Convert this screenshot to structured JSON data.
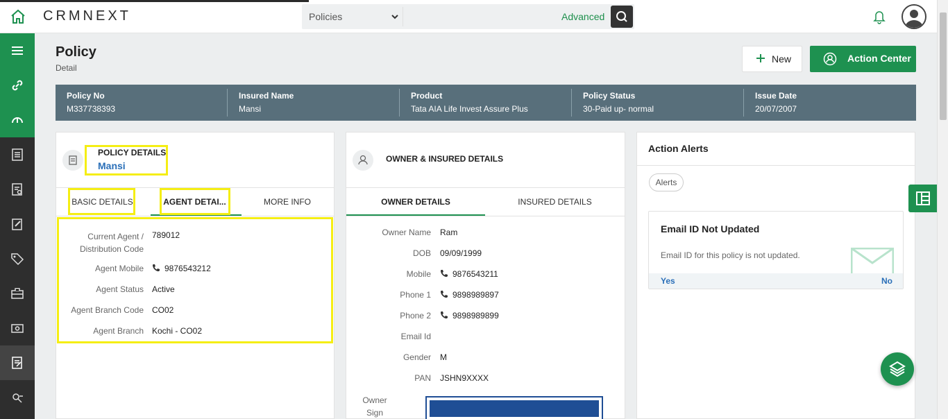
{
  "app": {
    "logo": "CRMNEXT"
  },
  "search": {
    "module": "Policies",
    "advanced_label": "Advanced"
  },
  "page": {
    "title": "Policy",
    "subtitle": "Detail"
  },
  "actions": {
    "new_label": "New",
    "action_center_label": "Action Center"
  },
  "summary": [
    {
      "key": "Policy No",
      "value": "M337738393"
    },
    {
      "key": "Insured Name",
      "value": "Mansi"
    },
    {
      "key": "Product",
      "value": "Tata AIA Life Invest Assure Plus"
    },
    {
      "key": "Policy Status",
      "value": "30-Paid up- normal"
    },
    {
      "key": "Issue Date",
      "value": "20/07/2007"
    }
  ],
  "policy_card": {
    "title": "POLICY DETAILS",
    "name": "Mansi",
    "tabs": [
      "BASIC DETAILS",
      "AGENT DETAI...",
      "MORE INFO"
    ],
    "fields": [
      {
        "label": "Current Agent / Distribution Code",
        "value": "789012"
      },
      {
        "label": "Agent Mobile",
        "value": "9876543212"
      },
      {
        "label": "Agent Status",
        "value": "Active"
      },
      {
        "label": "Agent Branch Code",
        "value": "CO02"
      },
      {
        "label": "Agent Branch",
        "value": "Kochi - CO02"
      }
    ]
  },
  "owner_card": {
    "title": "OWNER & INSURED DETAILS",
    "tabs": [
      "OWNER DETAILS",
      "INSURED DETAILS"
    ],
    "fields": [
      {
        "label": "Owner Name",
        "value": "Ram"
      },
      {
        "label": "DOB",
        "value": "09/09/1999"
      },
      {
        "label": "Mobile",
        "value": "9876543211"
      },
      {
        "label": "Phone 1",
        "value": "9898989897"
      },
      {
        "label": "Phone 2",
        "value": "9898989899"
      },
      {
        "label": "Email Id",
        "value": ""
      },
      {
        "label": "Gender",
        "value": "M"
      },
      {
        "label": "PAN",
        "value": "JSHN9XXXX"
      },
      {
        "label": "Owner Sign",
        "value": ""
      }
    ]
  },
  "alerts_card": {
    "title": "Action Alerts",
    "pill": "Alerts",
    "alert": {
      "title": "Email ID Not Updated",
      "description": "Email ID for this policy is not updated.",
      "yes": "Yes",
      "no": "No"
    }
  },
  "colors": {
    "brand_green": "#1e9150",
    "infobar": "#586f7b",
    "highlight": "#f5ee14",
    "link_blue": "#2a6fb8"
  }
}
